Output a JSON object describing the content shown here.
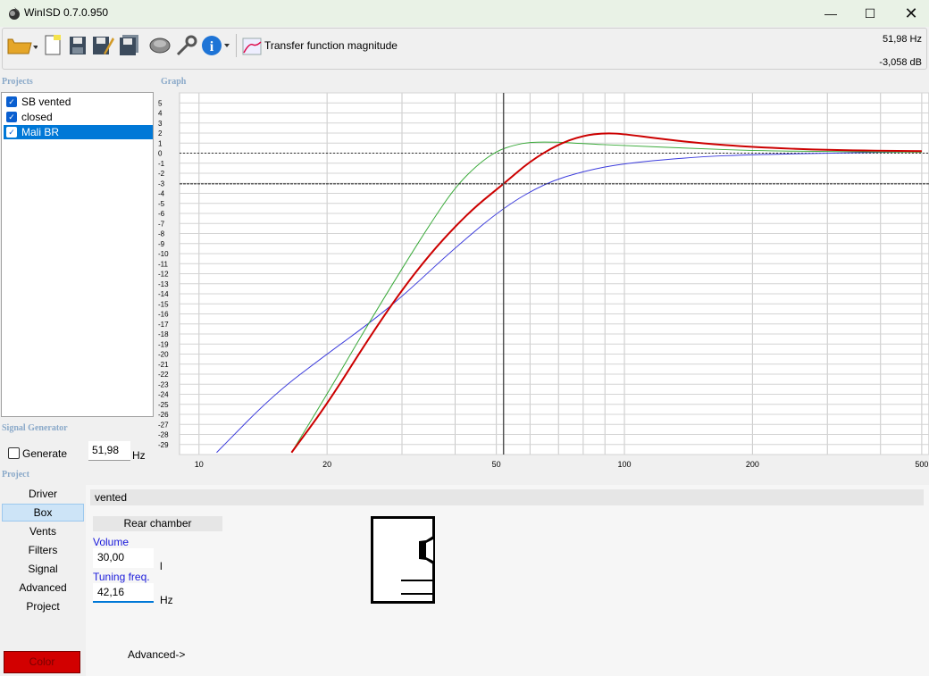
{
  "window": {
    "title": "WinISD 0.7.0.950"
  },
  "toolbar": {
    "graph_selector": "Transfer function magnitude",
    "readout_freq": "51,98 Hz",
    "readout_level": "-3,058 dB"
  },
  "labels": {
    "projects": "Projects",
    "graph": "Graph",
    "signal_generator": "Signal Generator",
    "project": "Project"
  },
  "projects": [
    {
      "name": "SB vented",
      "checked": true,
      "selected": false
    },
    {
      "name": "closed",
      "checked": true,
      "selected": false
    },
    {
      "name": "Mali BR",
      "checked": true,
      "selected": true
    }
  ],
  "signal_generator": {
    "generate_label": "Generate",
    "frequency": "51,98",
    "unit": "Hz"
  },
  "project_nav": [
    "Driver",
    "Box",
    "Vents",
    "Filters",
    "Signal",
    "Advanced",
    "Project"
  ],
  "project_nav_active": "Box",
  "color_button": "Color",
  "box": {
    "type": "vented",
    "chamber": "Rear chamber",
    "volume_label": "Volume",
    "volume_value": "30,00",
    "volume_unit": "l",
    "tuning_label": "Tuning freq.",
    "tuning_value": "42,16",
    "tuning_unit": "Hz",
    "advanced": "Advanced->"
  },
  "chart_data": {
    "type": "line",
    "xscale": "log",
    "xlim": [
      9,
      520
    ],
    "ylim": [
      -30,
      6
    ],
    "xticks": [
      "10",
      "20",
      "50",
      "100",
      "200",
      "500"
    ],
    "yticks": [
      "5",
      "4",
      "3",
      "2",
      "1",
      "0",
      "-1",
      "-2",
      "-3",
      "-4",
      "-5",
      "-6",
      "-7",
      "-8",
      "-9",
      "-10",
      "-11",
      "-12",
      "-13",
      "-14",
      "-15",
      "-16",
      "-17",
      "-18",
      "-19",
      "-20",
      "-21",
      "-22",
      "-23",
      "-24",
      "-25",
      "-26",
      "-27",
      "-28",
      "-29"
    ],
    "cursor_x": 51.98,
    "cursor_y": -3.058,
    "reference_y": 0,
    "grid": true,
    "series": [
      {
        "color": "#3b3bdc",
        "x": [
          11,
          15,
          20,
          25,
          30,
          40,
          52,
          65,
          80,
          100,
          150,
          200,
          300,
          500
        ],
        "y": [
          -29.8,
          -24,
          -20,
          -17,
          -14.3,
          -9.4,
          -5.4,
          -3,
          -1.8,
          -1.0,
          -0.35,
          -0.15,
          0,
          0.15
        ]
      },
      {
        "color": "#3aaa3a",
        "x": [
          16.5,
          20,
          25,
          30,
          35,
          40,
          45,
          50,
          55,
          60,
          70,
          80,
          100,
          150,
          200,
          300,
          500
        ],
        "y": [
          -29.8,
          -24,
          -17,
          -11.5,
          -7,
          -3.4,
          -1.2,
          0.2,
          0.8,
          1.1,
          1.1,
          0.95,
          0.75,
          0.45,
          0.25,
          0.15,
          0.1
        ]
      },
      {
        "color": "#cc0000",
        "x": [
          16.5,
          20,
          25,
          30,
          35,
          40,
          45,
          52,
          60,
          70,
          80,
          90,
          100,
          120,
          150,
          200,
          300,
          500
        ],
        "y": [
          -29.8,
          -25,
          -18.5,
          -13.6,
          -10,
          -7.3,
          -5.2,
          -3.06,
          -0.8,
          0.9,
          1.75,
          2.0,
          1.9,
          1.45,
          1.0,
          0.6,
          0.3,
          0.2
        ]
      }
    ]
  },
  "colors": {
    "accent": "#0078d7",
    "project_color": "#d20000"
  }
}
